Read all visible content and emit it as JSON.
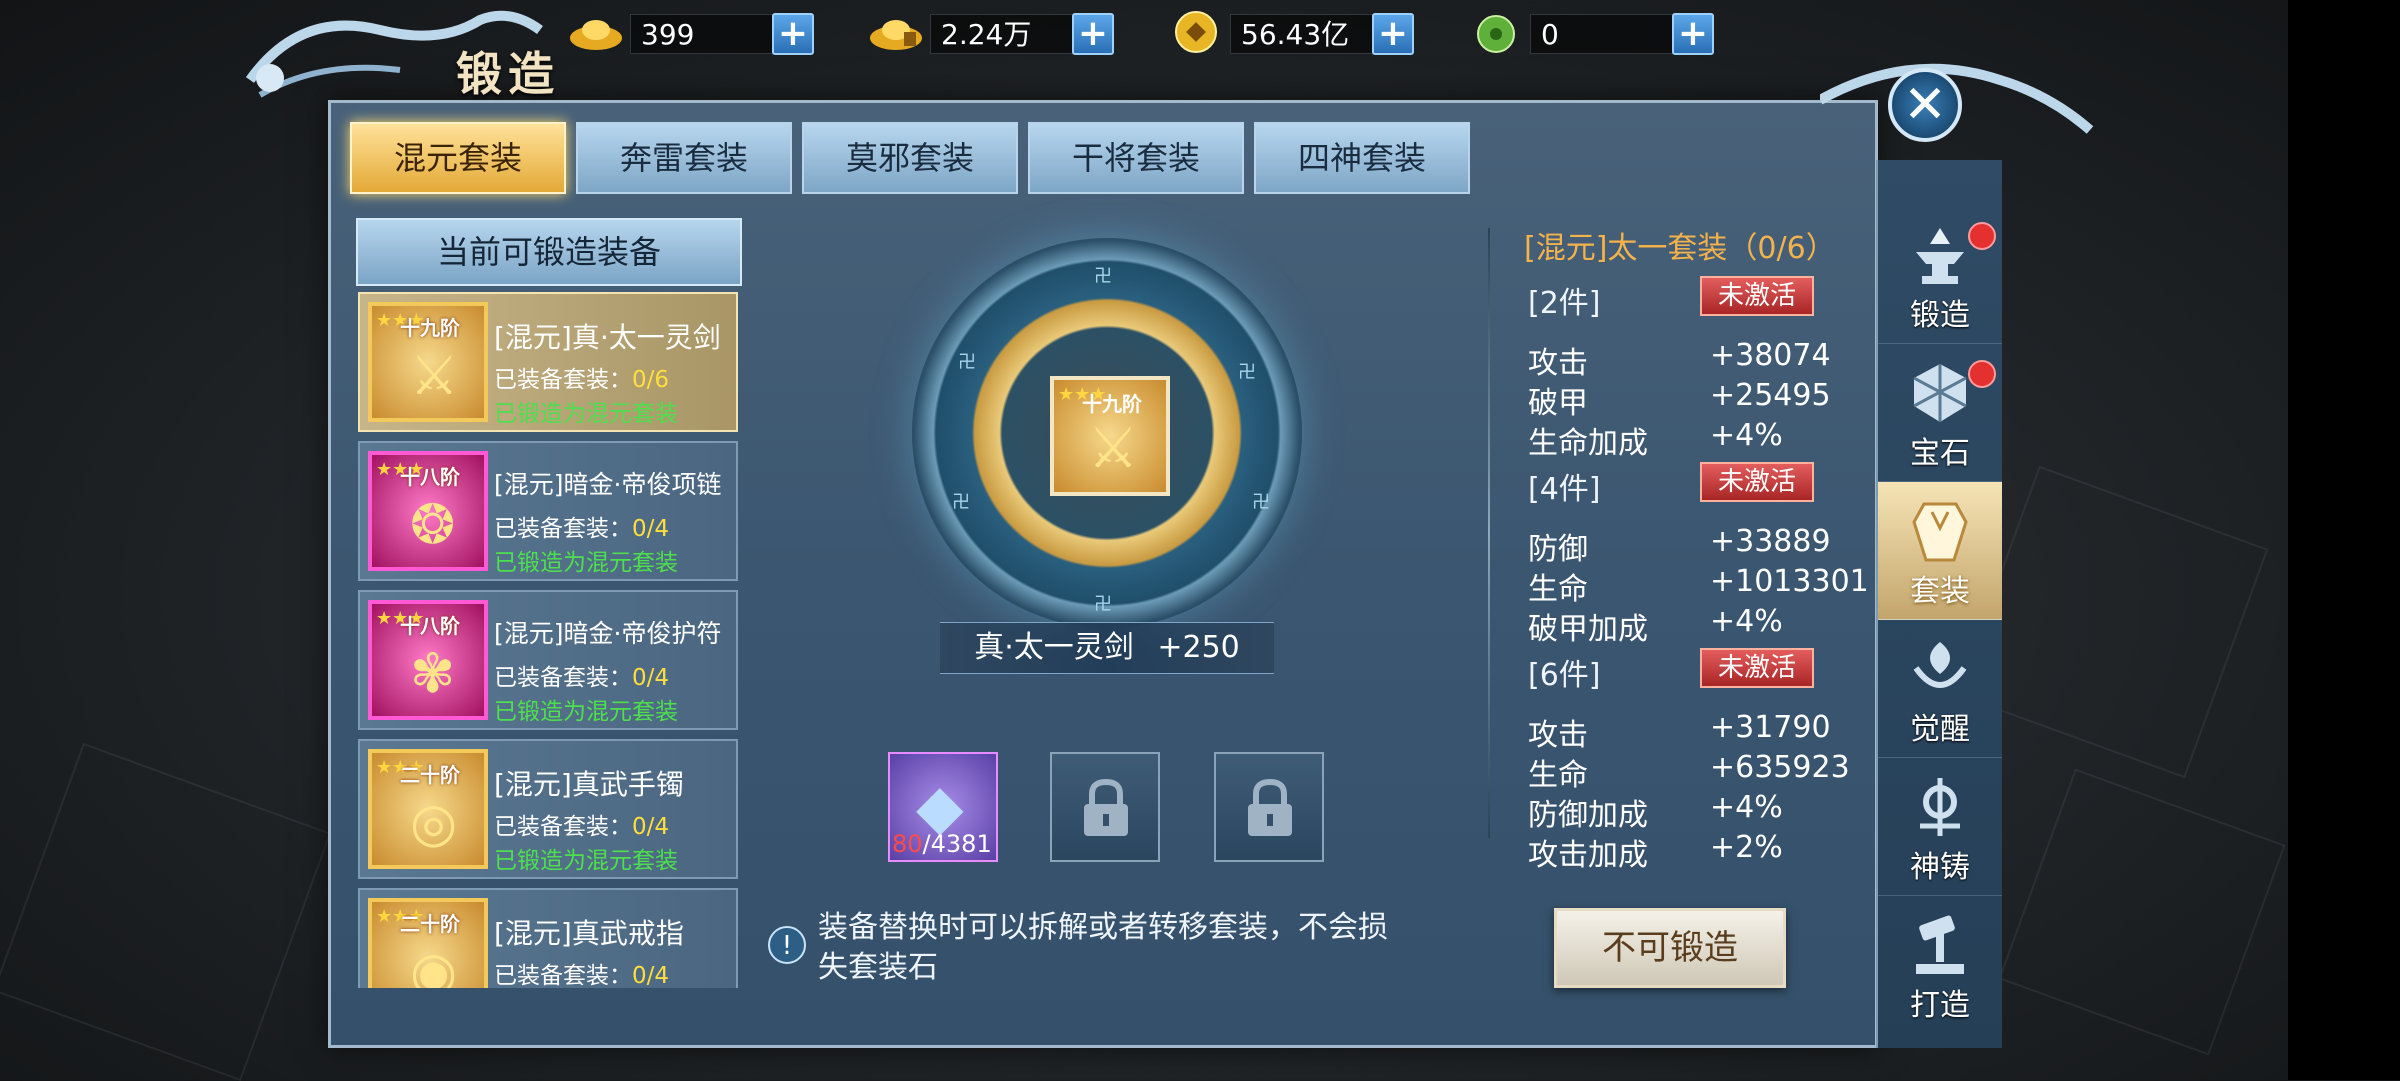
{
  "currency": [
    {
      "icon": "gold-ingot-icon",
      "value": "399"
    },
    {
      "icon": "bound-gold-ingot-icon",
      "value": "2.24万"
    },
    {
      "icon": "coin-icon",
      "value": "56.43亿"
    },
    {
      "icon": "jade-icon",
      "value": "0"
    }
  ],
  "title": "锻造",
  "tabs": [
    {
      "label": "混元套装",
      "active": true
    },
    {
      "label": "奔雷套装",
      "active": false
    },
    {
      "label": "莫邪套装",
      "active": false
    },
    {
      "label": "干将套装",
      "active": false
    },
    {
      "label": "四神套装",
      "active": false
    }
  ],
  "list_header": "当前可锻造装备",
  "items": [
    {
      "rank": "十九阶",
      "name": "[混元]真·太一灵剑",
      "set_label": "已装备套装：",
      "set_count": "0/6",
      "forged": "已锻造为混元套装",
      "selected": true
    },
    {
      "rank": "十八阶",
      "name": "[混元]暗金·帝俊项链",
      "set_label": "已装备套装：",
      "set_count": "0/4",
      "forged": "已锻造为混元套装",
      "selected": false
    },
    {
      "rank": "十八阶",
      "name": "[混元]暗金·帝俊护符",
      "set_label": "已装备套装：",
      "set_count": "0/4",
      "forged": "已锻造为混元套装",
      "selected": false
    },
    {
      "rank": "二十阶",
      "name": "[混元]真武手镯",
      "set_label": "已装备套装：",
      "set_count": "0/4",
      "forged": "已锻造为混元套装",
      "selected": false
    },
    {
      "rank": "二十阶",
      "name": "[混元]真武戒指",
      "set_label": "已装备套装：",
      "set_count": "0/4",
      "forged": "",
      "selected": false
    }
  ],
  "center": {
    "rank": "十九阶",
    "name": "真·太一灵剑",
    "level": "+250",
    "gem_have": "80",
    "gem_need": "/4381"
  },
  "tip": "装备替换时可以拆解或者转移套装，不会损失套装石",
  "set_info": {
    "title": "[混元]太一套装（0/6）",
    "tiers": [
      {
        "label": "[2件]",
        "status": "未激活",
        "stats": [
          {
            "k": "攻击",
            "v": "+38074"
          },
          {
            "k": "破甲",
            "v": "+25495"
          },
          {
            "k": "生命加成",
            "v": "+4%"
          }
        ]
      },
      {
        "label": "[4件]",
        "status": "未激活",
        "stats": [
          {
            "k": "防御",
            "v": "+33889"
          },
          {
            "k": "生命",
            "v": "+1013301"
          },
          {
            "k": "破甲加成",
            "v": "+4%"
          }
        ]
      },
      {
        "label": "[6件]",
        "status": "未激活",
        "stats": [
          {
            "k": "攻击",
            "v": "+31790"
          },
          {
            "k": "生命",
            "v": "+635923"
          },
          {
            "k": "防御加成",
            "v": "+4%"
          },
          {
            "k": "攻击加成",
            "v": "+2%"
          }
        ]
      }
    ]
  },
  "forge_button": "不可锻造",
  "sidebar": [
    {
      "label": "锻造",
      "icon": "anvil-icon",
      "dot": true,
      "active": false
    },
    {
      "label": "宝石",
      "icon": "gem-icon",
      "dot": true,
      "active": false
    },
    {
      "label": "套装",
      "icon": "armor-set-icon",
      "dot": false,
      "active": true
    },
    {
      "label": "觉醒",
      "icon": "awaken-icon",
      "dot": false,
      "active": false
    },
    {
      "label": "神铸",
      "icon": "divine-cast-icon",
      "dot": false,
      "active": false
    },
    {
      "label": "打造",
      "icon": "hammer-icon",
      "dot": false,
      "active": false
    }
  ],
  "colors": {
    "accent_gold": "#f3c95b",
    "set_title": "#f4b24a",
    "inactive_red": "#c93838",
    "forged_green": "#4de04d"
  }
}
